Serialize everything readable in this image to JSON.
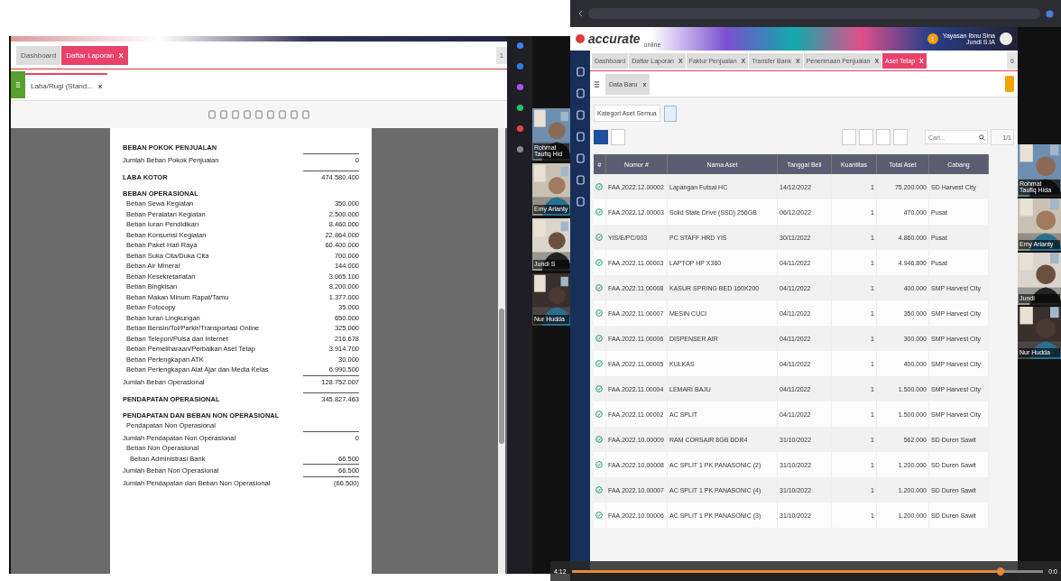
{
  "left_window": {
    "tabs": [
      {
        "label": "Dashboard",
        "selected": false
      },
      {
        "label": "Daftar Laporan",
        "selected": true,
        "close": "X"
      }
    ],
    "page_menu": "1",
    "subtab": {
      "label": "Laba/Rugi (Stand...",
      "close": "x"
    },
    "report_rows": [
      {
        "kind": "heading",
        "label": "BEBAN POKOK PENJUALAN"
      },
      {
        "kind": "total",
        "label": "Jumlah Beban Pokok Penjualan",
        "value": "0"
      },
      {
        "kind": "grand",
        "label": "LABA KOTOR",
        "value": "474.580.400"
      },
      {
        "kind": "heading",
        "label": "BEBAN OPERASIONAL"
      },
      {
        "kind": "item",
        "label": "Beban Sewa Kegiatan",
        "value": "350.000"
      },
      {
        "kind": "item",
        "label": "Beban Peralatan Kegiatan",
        "value": "2.500.000"
      },
      {
        "kind": "item",
        "label": "Beban Iuran Pendidikan",
        "value": "8.460.000"
      },
      {
        "kind": "item",
        "label": "Beban Konsumsi Kegiatan",
        "value": "22.864.000"
      },
      {
        "kind": "item",
        "label": "Beban Paket Hari Raya",
        "value": "60.400.000"
      },
      {
        "kind": "item",
        "label": "Beban Suka Cita/Duka Cita",
        "value": "700.000"
      },
      {
        "kind": "item",
        "label": "Beban Air Mineral",
        "value": "144.000"
      },
      {
        "kind": "item",
        "label": "Beban Kesekretariatan",
        "value": "3.065.100"
      },
      {
        "kind": "item",
        "label": "Beban Bingkisan",
        "value": "8.200.000"
      },
      {
        "kind": "item",
        "label": "Beban Makan Minum Rapat/Tamu",
        "value": "1.377.000"
      },
      {
        "kind": "item",
        "label": "Beban Fotocopy",
        "value": "35.000"
      },
      {
        "kind": "item",
        "label": "Beban Iuran Lingkungan",
        "value": "650.000"
      },
      {
        "kind": "item",
        "label": "Beban Bensin/Tol/Parkir/Transportasi Online",
        "value": "325.000"
      },
      {
        "kind": "item",
        "label": "Beban Telepon/Pulsa dan Internet",
        "value": "216.678"
      },
      {
        "kind": "item",
        "label": "Beban Pemeliharaan/Perbaikan Aset Tetap",
        "value": "3.914.700"
      },
      {
        "kind": "item",
        "label": "Beban Perlengkapan ATK",
        "value": "30.000"
      },
      {
        "kind": "item",
        "label": "Beban Perlengkapan Alat Ajar dan Media Kelas",
        "value": "6.990.500"
      },
      {
        "kind": "total",
        "label": "Jumlah Beban Operasional",
        "value": "128.752.007"
      },
      {
        "kind": "grand",
        "label": "PENDAPATAN OPERASIONAL",
        "value": "345.827.463"
      },
      {
        "kind": "heading",
        "label": "PENDAPATAN DAN BEBAN NON OPERASIONAL"
      },
      {
        "kind": "item",
        "label": "Pendapatan Non Operasional"
      },
      {
        "kind": "total",
        "label": "Jumlah Pendapatan Non Operasional",
        "value": "0"
      },
      {
        "kind": "item",
        "label": "Beban Non Operasional"
      },
      {
        "kind": "subitem",
        "label": "Beban Administrasi Bank",
        "value": "66.500"
      },
      {
        "kind": "total",
        "label": "Jumlah Beban Non Operasional",
        "value": "66.500"
      },
      {
        "kind": "total",
        "label": "Jumlah Pendapatan dan Beban Non Operasional",
        "value": "(66.500)"
      }
    ]
  },
  "left_participants": [
    {
      "name": "Rohmat Taufiq Hid"
    },
    {
      "name": "Emy Arianty"
    },
    {
      "name": "Jundi S"
    },
    {
      "name": "Nur Hudda"
    }
  ],
  "right_window": {
    "brand": "accurate",
    "brand_sub": "online",
    "notification_count": "1",
    "user_name": "Yayasan Ibnu Sina",
    "user_sub": "Jundi S.IA",
    "tabs": [
      {
        "label": "Dashboard",
        "selected": false
      },
      {
        "label": "Daftar Laporan",
        "selected": false,
        "close": "X"
      },
      {
        "label": "Faktur Penjualan",
        "selected": false,
        "close": "X"
      },
      {
        "label": "Transfer Bank",
        "selected": false,
        "close": "X"
      },
      {
        "label": "Penerimaan Penjualan",
        "selected": false,
        "close": "X"
      },
      {
        "label": "Aset Tetap",
        "selected": true,
        "close": "X"
      }
    ],
    "page_menu": "6",
    "subtab": {
      "label": "Data Baru",
      "close": "x"
    },
    "filter": "Kategori Aset Semua",
    "search": {
      "placeholder": "Cari..."
    },
    "page_indicator": "1/1",
    "index_header": "#",
    "columns": [
      "Nomor #",
      "Nama Aset",
      "Tanggal Beli",
      "Kuantitas",
      "Total Aset",
      "Cabang"
    ],
    "rows": [
      [
        "FAA.2022.12.00002",
        "Lapangan Futsal HC",
        "14/12/2022",
        "1",
        "75.200.000",
        "SD Harvest City"
      ],
      [
        "FAA.2022.12.00003",
        "Solid State Drive (SSD) 256GB",
        "06/12/2022",
        "1",
        "470.000",
        "Pusat"
      ],
      [
        "YIS/E/PC/003",
        "PC STAFF HRD YIS",
        "30/11/2022",
        "1",
        "4.860.000",
        "Pusat"
      ],
      [
        "FAA.2022.11.00003",
        "LAPTOP HP X360",
        "04/11/2022",
        "1",
        "4.946.800",
        "Pusat"
      ],
      [
        "FAA.2022.11.00008",
        "KASUR SPRING BED 160X200",
        "04/11/2022",
        "1",
        "400.000",
        "SMP Harvest City"
      ],
      [
        "FAA.2022.11.00007",
        "MESIN CUCI",
        "04/11/2022",
        "1",
        "350.000",
        "SMP Harvest City"
      ],
      [
        "FAA.2022.11.00006",
        "DISPENSER AIR",
        "04/11/2022",
        "1",
        "300.000",
        "SMP Harvest City"
      ],
      [
        "FAA.2022.11.00005",
        "KULKAS",
        "04/11/2022",
        "1",
        "400.000",
        "SMP Harvest City"
      ],
      [
        "FAA.2022.11.00004",
        "LEMARI BAJU",
        "04/11/2022",
        "1",
        "1.500.000",
        "SMP Harvest City"
      ],
      [
        "FAA.2022.11.00002",
        "AC SPLIT",
        "04/11/2022",
        "1",
        "1.500.000",
        "SMP Harvest City"
      ],
      [
        "FAA.2022.10.00009",
        "RAM CORSAIR 8GB DDR4",
        "31/10/2022",
        "1",
        "562.000",
        "SD Duren Sawit"
      ],
      [
        "FAA.2022.10.00008",
        "AC SPLIT 1 PK PANASONIC (2)",
        "31/10/2022",
        "1",
        "1.200.000",
        "SD Duren Sawit"
      ],
      [
        "FAA.2022.10.00007",
        "AC SPLIT 1 PK PANASONIC (4)",
        "31/10/2022",
        "1",
        "1.200.000",
        "SD Duren Sawit"
      ],
      [
        "FAA.2022.10.00006",
        "AC SPLIT 1 PK PANASONIC (3)",
        "31/10/2022",
        "1",
        "1.200.000",
        "SD Duren Sawit"
      ]
    ]
  },
  "video_bar": {
    "elapsed": "4:12",
    "level": 0.91,
    "remaining": "0:0"
  },
  "right_participants": [
    {
      "name": "Rohmat Taufiq Hida"
    },
    {
      "name": "Emy Arianty"
    },
    {
      "name": "Jundi"
    },
    {
      "name": "Nur Hudda"
    }
  ]
}
